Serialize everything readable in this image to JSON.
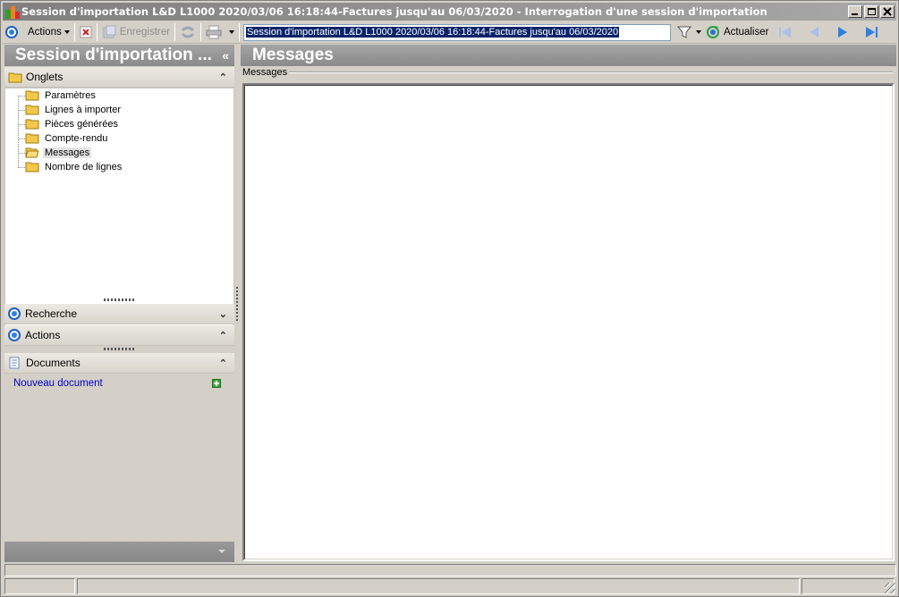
{
  "window": {
    "title": "Session d'importation L&D L1000 2020/03/06 16:18:44-Factures jusqu'au 06/03/2020 -  Interrogation d'une session d'importation"
  },
  "toolbar": {
    "actions_label": "Actions",
    "save_label": "Enregistrer",
    "session_value": "Session d'importation L&D L1000 2020/03/06 16:18:44-Factures jusqu'au 06/03/2020",
    "refresh_label": "Actualiser"
  },
  "left_panel": {
    "title": "Session d'importation ...",
    "onglets_label": "Onglets",
    "tree_items": [
      {
        "label": "Paramètres"
      },
      {
        "label": "Lignes à importer"
      },
      {
        "label": "Pièces générées"
      },
      {
        "label": "Compte-rendu"
      },
      {
        "label": "Messages"
      },
      {
        "label": "Nombre de lignes"
      }
    ],
    "recherche_label": "Recherche",
    "actions_label": "Actions",
    "documents_label": "Documents",
    "new_document_label": "Nouveau document"
  },
  "main": {
    "title": "Messages",
    "group_label": "Messages"
  }
}
